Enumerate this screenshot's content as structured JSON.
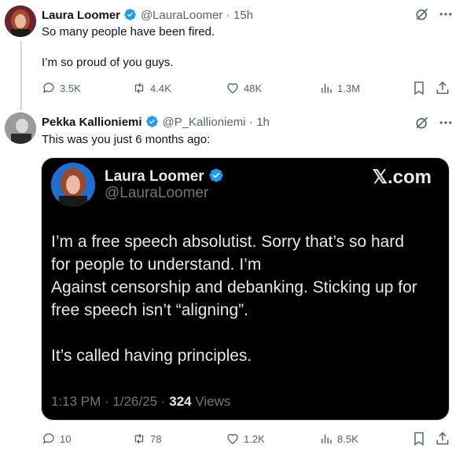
{
  "post1": {
    "name": "Laura Loomer",
    "handle": "@LauraLoomer",
    "time": "· 15h",
    "line1": "So many people have been fired.",
    "line2": "I’m so proud of you guys.",
    "replies": "3.5K",
    "reposts": "4.4K",
    "likes": "48K",
    "views": "1.3M"
  },
  "post2": {
    "name": "Pekka Kallioniemi",
    "handle": "@P_Kallioniemi",
    "time": "· 1h",
    "text": "This was you just 6 months ago:",
    "replies": "10",
    "reposts": "78",
    "likes": "1.2K",
    "views": "8.5K"
  },
  "quote_card": {
    "name": "Laura Loomer",
    "handle": "@LauraLoomer",
    "brand": "𝕏.com",
    "body_lines": [
      "I’m a free speech absolutist. Sorry that’s so hard",
      "for people to understand. I’m",
      "Against censorship and debanking. Sticking up for",
      "free speech isn’t “aligning”.",
      "",
      "It’s called having principles."
    ],
    "time": "1:13 PM · 1/26/25 ·",
    "views_count": "324",
    "views_label": "Views"
  },
  "colors": {
    "accent": "#1d9bf0",
    "muted": "#536471",
    "card_bg": "#000000"
  }
}
